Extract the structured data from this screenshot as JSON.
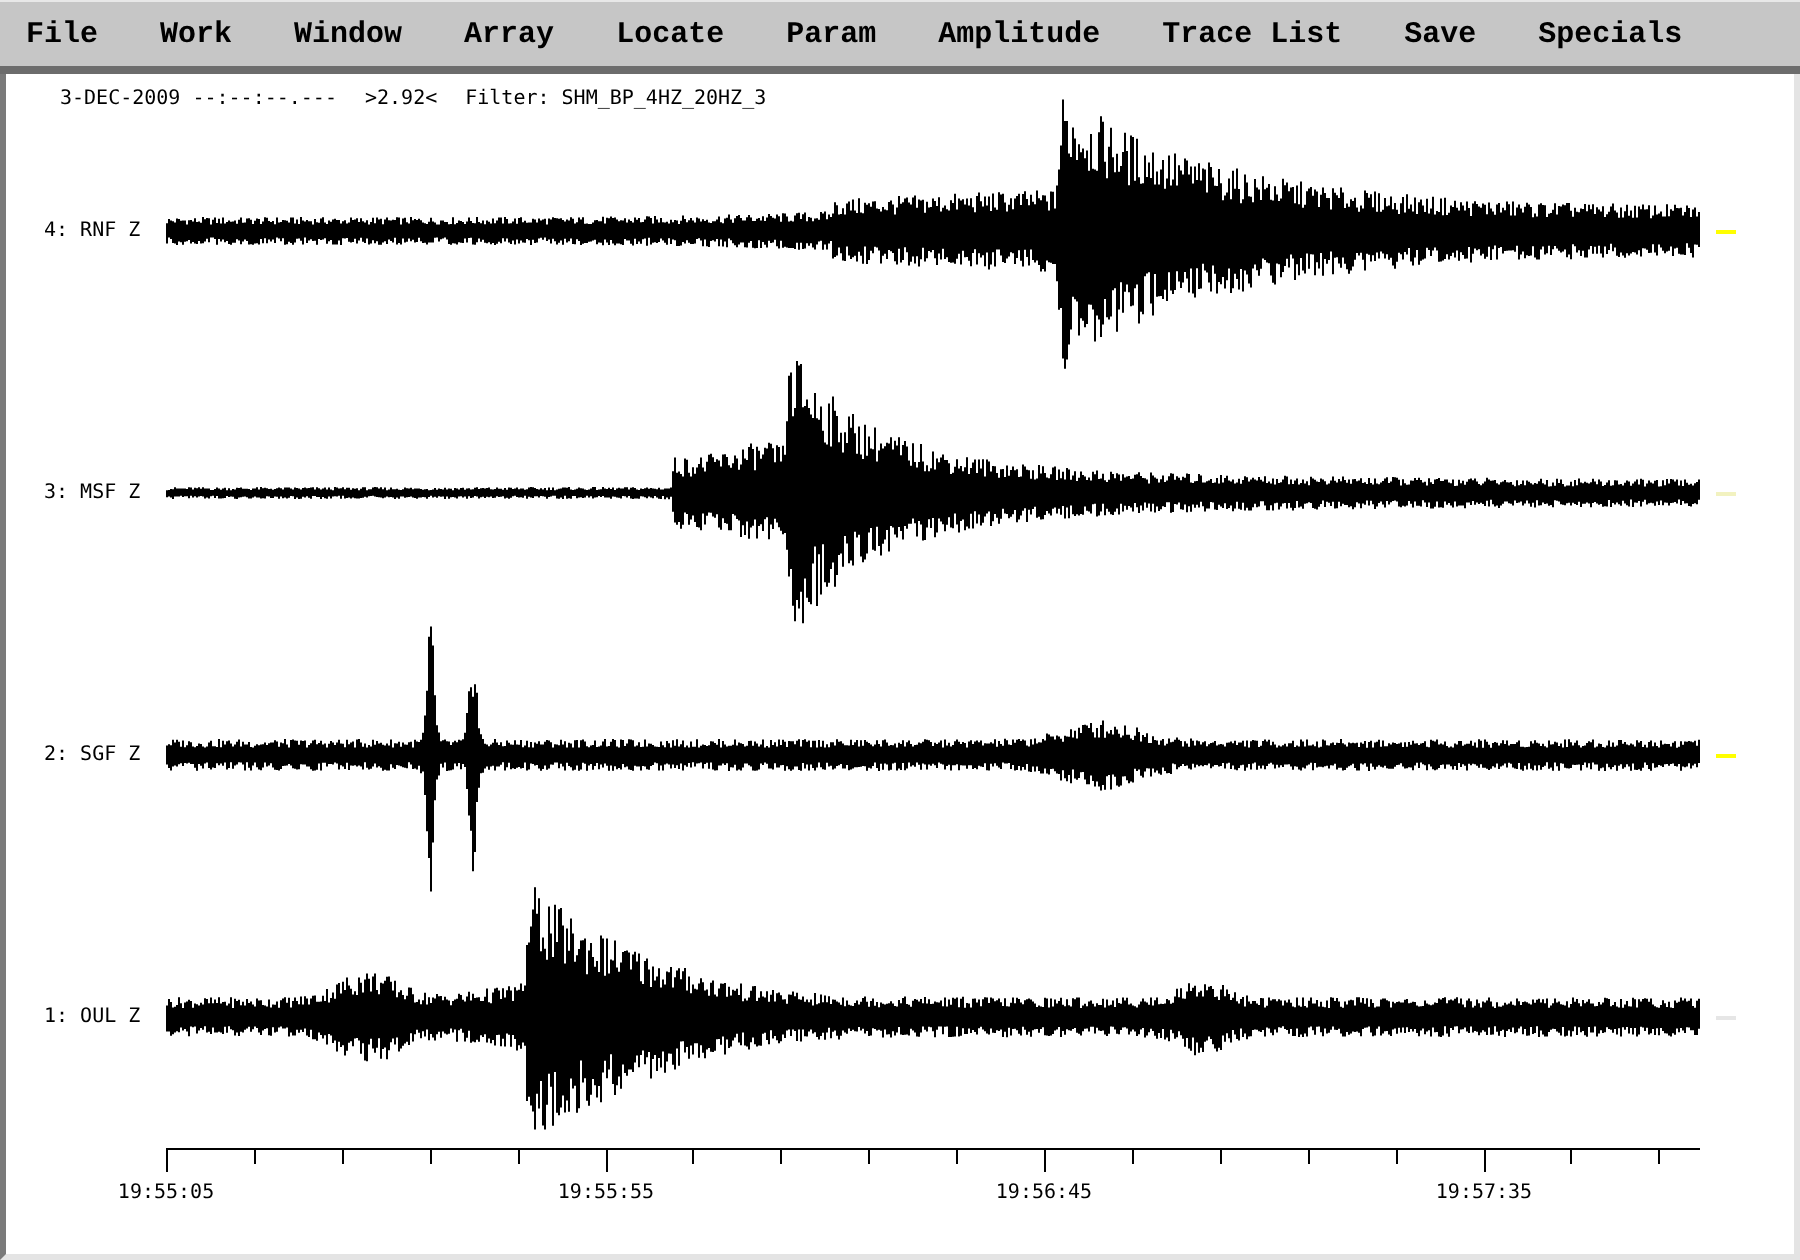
{
  "menu": [
    {
      "label": "File"
    },
    {
      "label": "Work"
    },
    {
      "label": "Window"
    },
    {
      "label": "Array"
    },
    {
      "label": "Locate"
    },
    {
      "label": "Param"
    },
    {
      "label": "Amplitude"
    },
    {
      "label": "Trace List"
    },
    {
      "label": "Save"
    },
    {
      "label": "Specials"
    }
  ],
  "header": {
    "date": "3-DEC-2009 --:--:--.---",
    "amplitude": ">2.92<",
    "filter": "Filter: SHM_BP_4HZ_20HZ_3"
  },
  "traces": [
    {
      "label": "4: RNF Z",
      "color": "#ffff00"
    },
    {
      "label": "3: MSF Z",
      "color": "#f2f2c0"
    },
    {
      "label": "2: SGF Z",
      "color": "#ffff00"
    },
    {
      "label": "1: OUL Z",
      "color": "#e6e6e6"
    }
  ],
  "time_axis": {
    "ticks": [
      "19:55:05",
      "19:55:55",
      "19:56:45",
      "19:57:35"
    ]
  }
}
